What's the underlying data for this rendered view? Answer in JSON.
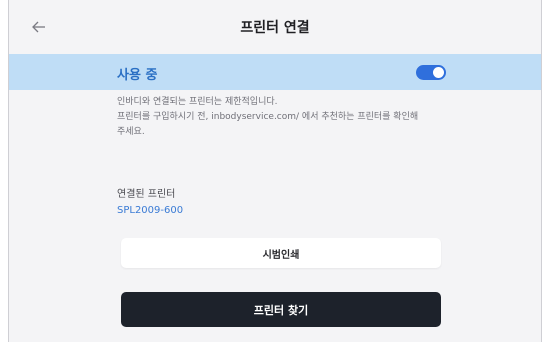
{
  "header": {
    "title": "프린터 연결",
    "back_icon": "back-arrow-icon"
  },
  "status": {
    "label": "사용 중",
    "toggle_on": true,
    "colors": {
      "bar": "#bfddf6",
      "label": "#2a6fc4",
      "toggle": "#2f6fdc"
    }
  },
  "notice": {
    "line1": "인바디와 연결되는 프린터는 제한적입니다.",
    "line2": "프린터를 구입하시기 전, inbodyservice.com/ 에서 추천하는 프린터를 확인해",
    "line3": "주세요."
  },
  "connected": {
    "label": "연결된 프린터",
    "value": "SPL2009-600"
  },
  "buttons": {
    "test_print": "시범인쇄",
    "find_printer": "프린터 찾기"
  }
}
